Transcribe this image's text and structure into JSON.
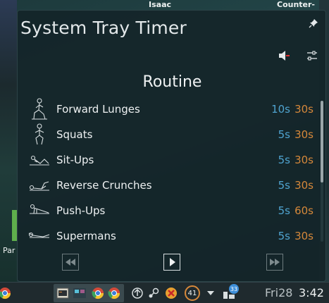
{
  "background": {
    "labels": [
      "Isaac",
      "Counter-",
      "Par"
    ]
  },
  "popup": {
    "title": "System Tray Timer",
    "section_title": "Routine",
    "icons": {
      "pin": "pin-icon",
      "mute": "speaker-muted-icon",
      "settings": "sliders-icon"
    },
    "exercises": [
      {
        "name": "Forward Lunges",
        "work": "10s",
        "rest": "30s",
        "icon": "lunge-figure-icon"
      },
      {
        "name": "Squats",
        "work": "5s",
        "rest": "30s",
        "icon": "squat-figure-icon"
      },
      {
        "name": "Sit-Ups",
        "work": "5s",
        "rest": "30s",
        "icon": "situp-figure-icon"
      },
      {
        "name": "Reverse Crunches",
        "work": "5s",
        "rest": "30s",
        "icon": "crunch-figure-icon"
      },
      {
        "name": "Push-Ups",
        "work": "5s",
        "rest": "60s",
        "icon": "pushup-figure-icon"
      },
      {
        "name": "Supermans",
        "work": "5s",
        "rest": "30s",
        "icon": "superman-figure-icon"
      }
    ],
    "controls": {
      "prev": "skip-back-icon",
      "play": "play-icon",
      "next": "skip-forward-icon"
    }
  },
  "taskbar": {
    "badge_value": "41",
    "notification_count": "33",
    "day": "Fri28",
    "time": "3:42"
  },
  "colors": {
    "work": "#4fa3cf",
    "rest": "#d6883a",
    "popup_bg": "#142529"
  }
}
